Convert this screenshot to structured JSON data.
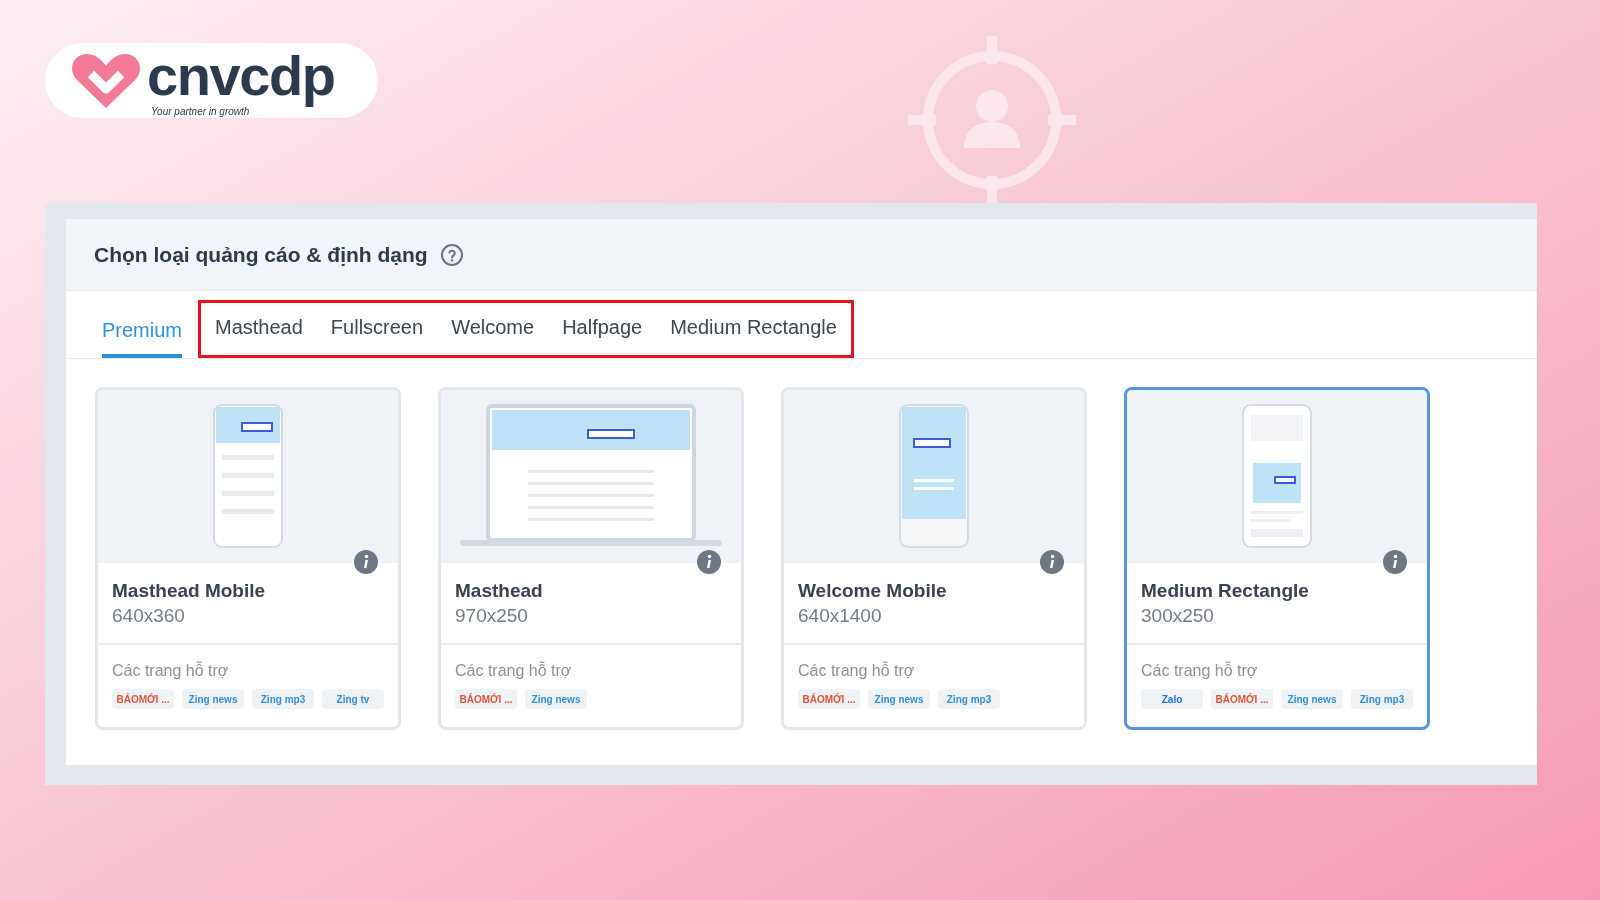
{
  "brand": {
    "name": "cnvcdp",
    "tagline": "Your partner in growth"
  },
  "panel": {
    "title": "Chọn loại quảng cáo & định dạng",
    "help_icon": true
  },
  "tabs": [
    {
      "label": "Premium",
      "selected": true,
      "highlighted": false
    },
    {
      "label": "Masthead",
      "selected": false,
      "highlighted": true
    },
    {
      "label": "Fullscreen",
      "selected": false,
      "highlighted": true
    },
    {
      "label": "Welcome",
      "selected": false,
      "highlighted": true
    },
    {
      "label": "Halfpage",
      "selected": false,
      "highlighted": true
    },
    {
      "label": "Medium Rectangle",
      "selected": false,
      "highlighted": true
    }
  ],
  "cards": [
    {
      "title": "Masthead Mobile",
      "size": "640x360",
      "kind": "mobile_top",
      "selected": false,
      "supported_label": "Các trang hỗ trợ",
      "sites": [
        {
          "label": "BÁOMỚI ...",
          "color": "#e0523a"
        },
        {
          "label": "Zing news",
          "color": "#2f8fdc"
        },
        {
          "label": "Zing mp3",
          "color": "#2f8fdc"
        },
        {
          "label": "Zing tv",
          "color": "#2f8fdc"
        }
      ]
    },
    {
      "title": "Masthead",
      "size": "970x250",
      "kind": "desktop",
      "selected": false,
      "supported_label": "Các trang hỗ trợ",
      "sites": [
        {
          "label": "BÁOMỚI ...",
          "color": "#e0523a"
        },
        {
          "label": "Zing news",
          "color": "#2f8fdc"
        }
      ]
    },
    {
      "title": "Welcome Mobile",
      "size": "640x1400",
      "kind": "mobile_full",
      "selected": false,
      "supported_label": "Các trang hỗ trợ",
      "sites": [
        {
          "label": "BÁOMỚI ...",
          "color": "#e0523a"
        },
        {
          "label": "Zing news",
          "color": "#2f8fdc"
        },
        {
          "label": "Zing mp3",
          "color": "#2f8fdc"
        }
      ]
    },
    {
      "title": "Medium Rectangle",
      "size": "300x250",
      "kind": "mobile_mid",
      "selected": true,
      "supported_label": "Các trang hỗ trợ",
      "sites": [
        {
          "label": "Zalo",
          "color": "#1f6fe0"
        },
        {
          "label": "BÁOMỚI ...",
          "color": "#e0523a"
        },
        {
          "label": "Zing news",
          "color": "#2f8fdc"
        },
        {
          "label": "Zing mp3",
          "color": "#2f8fdc"
        }
      ]
    }
  ]
}
